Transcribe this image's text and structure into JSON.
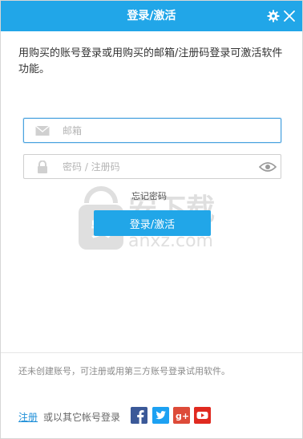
{
  "window": {
    "title": "登录/激活"
  },
  "description": "用购买的账号登录或用购买的邮箱/注册码登录可激活软件功能。",
  "email_field": {
    "placeholder": "邮箱"
  },
  "password_field": {
    "placeholder": "密码 / 注册码"
  },
  "forgot_password": "忘记密码",
  "login_button": "登录/激活",
  "watermark": {
    "text_cn": "安下载",
    "text_en": "anxz.com"
  },
  "footer": {
    "note": "还未创建账号，可注册或用第三方账号登录试用软件。",
    "register_link": "注册",
    "other_login": "或以其它帐号登录"
  },
  "social_icons": [
    "facebook-icon",
    "twitter-icon",
    "google-plus-icon",
    "youtube-icon"
  ],
  "colors": {
    "accent": "#21a6e8",
    "link": "#1f8fd8",
    "facebook": "#3b5998",
    "twitter": "#1da1f2",
    "google_plus": "#dd4b39",
    "youtube": "#e02a20"
  }
}
